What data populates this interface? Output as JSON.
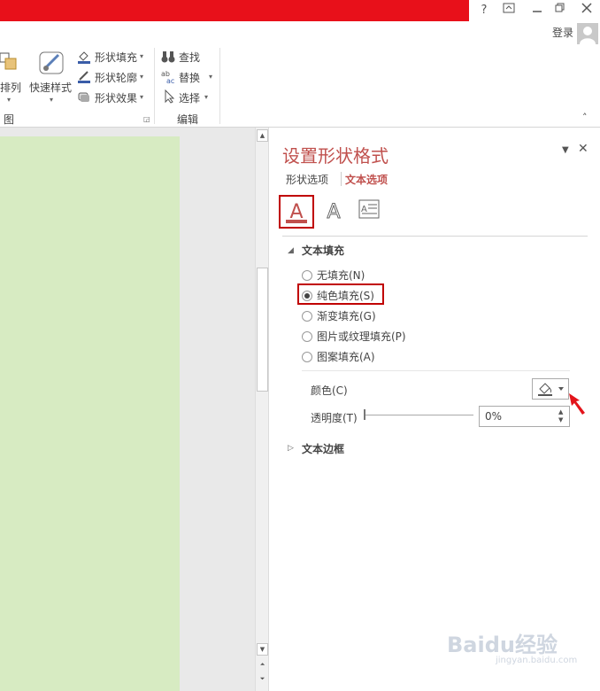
{
  "window": {
    "help": "?",
    "login": "登录"
  },
  "ribbon": {
    "arrange": "排列",
    "quick_styles": "快速样式",
    "shape_fill": "形状填充",
    "shape_outline": "形状轮廓",
    "shape_effects": "形状效果",
    "drawing_group": "图",
    "find": "查找",
    "replace": "替换",
    "select": "选择",
    "editing_group": "编辑"
  },
  "pane": {
    "title": "设置形状格式",
    "tabs": [
      "形状选项",
      "文本选项"
    ],
    "active_tab": "文本选项",
    "text_fill_header": "文本填充",
    "fill_options": [
      {
        "label": "无填充(N)",
        "checked": false
      },
      {
        "label": "纯色填充(S)",
        "checked": true
      },
      {
        "label": "渐变填充(G)",
        "checked": false
      },
      {
        "label": "图片或纹理填充(P)",
        "checked": false
      },
      {
        "label": "图案填充(A)",
        "checked": false
      }
    ],
    "color_label": "颜色(C)",
    "transparency_label": "透明度(T)",
    "transparency_value": "0%",
    "text_outline_header": "文本边框"
  },
  "watermark": {
    "text": "Baidu经验",
    "sub": "jingyan.baidu.com"
  },
  "colors": {
    "accent": "#c0504d",
    "highlight": "#c00000",
    "title_bar": "#e8101a",
    "slide": "#d7ebc2"
  }
}
